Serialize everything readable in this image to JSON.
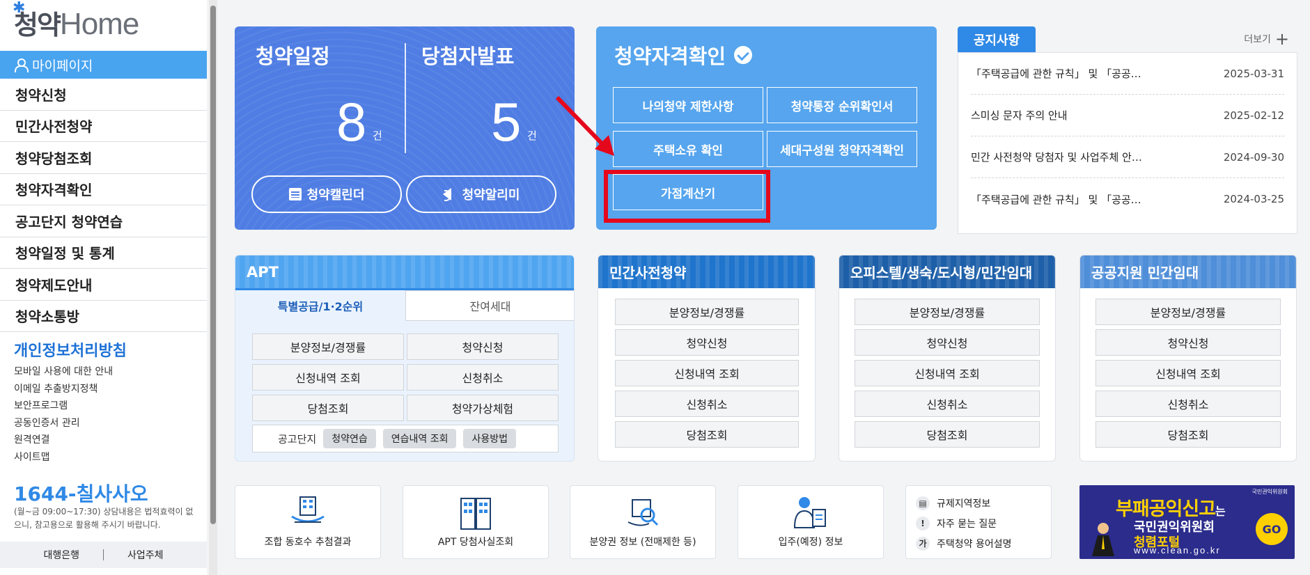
{
  "logo": {
    "han": "청약",
    "home": "Home"
  },
  "sidebar": {
    "mypage": "마이페이지",
    "items": [
      "청약신청",
      "민간사전청약",
      "청약당첨조회",
      "청약자격확인",
      "공고단지 청약연습",
      "청약일정 및 통계",
      "청약제도안내",
      "청약소통방"
    ],
    "policy": "개인정보처리방침",
    "sublinks": [
      "모바일 사용에 대한 안내",
      "이메일 추출방지정책",
      "보안프로그램",
      "공동인증서 관리",
      "원격연결",
      "사이트맵"
    ],
    "phone_prefix": "1644-",
    "phone_word": "칠사사오",
    "phone_note": "(월~금 09:00~17:30) 상담내용은 법적효력이 없으니, 참고용으로 활용해 주시기 바랍니다.",
    "bottom_links": [
      "대행은행",
      "사업주체"
    ]
  },
  "schedule": {
    "title1": "청약일정",
    "count1": "8",
    "title2": "당첨자발표",
    "count2": "5",
    "unit": "건",
    "btn_calendar": "청약캘린더",
    "btn_alarm": "청약알리미"
  },
  "qualification": {
    "title": "청약자격확인",
    "buttons": [
      "나의청약 제한사항",
      "청약통장 순위확인서",
      "주택소유 확인",
      "세대구성원 청약자격확인",
      "가점계산기"
    ]
  },
  "notice": {
    "tab": "공지사항",
    "more": "더보기",
    "items": [
      {
        "title": "「주택공급에 관한 규칙」 및 「공공…",
        "date": "2025-03-31"
      },
      {
        "title": "스미싱 문자 주의 안내",
        "date": "2025-02-12"
      },
      {
        "title": "민간 사전청약 당첨자 및 사업주체 안…",
        "date": "2024-09-30"
      },
      {
        "title": "「주택공급에 관한 규칙」 및 「공공…",
        "date": "2024-03-25"
      }
    ]
  },
  "apt": {
    "title": "APT",
    "tab_active": "특별공급/1·2순위",
    "tab_other": "잔여세대",
    "buttons": [
      "분양정보/경쟁률",
      "청약신청",
      "신청내역 조회",
      "신청취소",
      "당첨조회",
      "청약가상체험"
    ],
    "public_label": "공고단지",
    "public_chips": [
      "청약연습",
      "연습내역 조회",
      "사용방법"
    ]
  },
  "pre": {
    "title": "민간사전청약",
    "buttons": [
      "분양정보/경쟁률",
      "청약신청",
      "신청내역 조회",
      "신청취소",
      "당첨조회"
    ]
  },
  "officetel": {
    "title": "오피스텔/생숙/도시형/민간임대",
    "buttons": [
      "분양정보/경쟁률",
      "청약신청",
      "신청내역 조회",
      "신청취소",
      "당첨조회"
    ]
  },
  "public_rent": {
    "title": "공공지원 민간임대",
    "buttons": [
      "분양정보/경쟁률",
      "청약신청",
      "신청내역 조회",
      "신청취소",
      "당첨조회"
    ]
  },
  "quick": [
    "조합 동호수 추첨결과",
    "APT 당첨사실조회",
    "분양권 정보 (전매제한 등)",
    "입주(예정) 정보"
  ],
  "info_list": [
    {
      "icon": "▤",
      "label": "규제지역정보"
    },
    {
      "icon": "!",
      "label": "자주 묻는 질문"
    },
    {
      "icon": "가",
      "label": "주택청약 용어설명"
    }
  ],
  "banner": {
    "line1": "부패공익신고",
    "line1_suffix": "는",
    "line2": "국민권익위원회",
    "line3": "청렴포털",
    "url": "www.clean.go.kr",
    "go": "GO",
    "org": "국민권익위원회"
  }
}
